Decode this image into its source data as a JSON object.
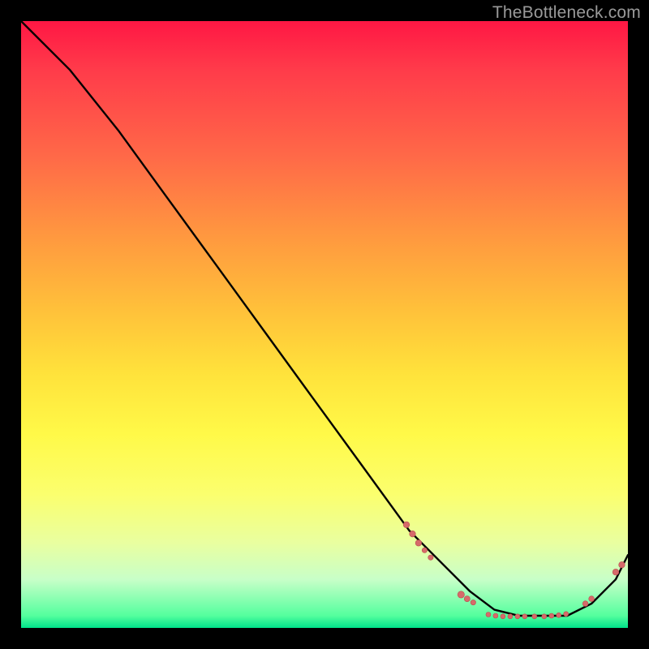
{
  "watermark": "TheBottleneck.com",
  "colors": {
    "line": "#000000",
    "marker_fill": "#d66a6a",
    "marker_stroke": "#b94e4e",
    "background": "#000000"
  },
  "chart_data": {
    "type": "line",
    "title": "",
    "xlabel": "",
    "ylabel": "",
    "xlim": [
      0,
      100
    ],
    "ylim": [
      0,
      100
    ],
    "grid": false,
    "legend": false,
    "series": [
      {
        "name": "curve",
        "x": [
          0,
          8,
          16,
          24,
          32,
          40,
          48,
          56,
          64,
          70,
          74,
          78,
          82,
          86,
          90,
          94,
          98,
          100
        ],
        "y": [
          100,
          92,
          82,
          71,
          60,
          49,
          38,
          27,
          16,
          10,
          6,
          3,
          2,
          2,
          2,
          4,
          8,
          12
        ]
      }
    ],
    "markers": [
      {
        "x": 63.5,
        "y": 17.0,
        "r": 3.8
      },
      {
        "x": 64.5,
        "y": 15.5,
        "r": 3.8
      },
      {
        "x": 65.5,
        "y": 14.0,
        "r": 3.8
      },
      {
        "x": 66.5,
        "y": 12.8,
        "r": 3.2
      },
      {
        "x": 67.5,
        "y": 11.6,
        "r": 3.2
      },
      {
        "x": 72.5,
        "y": 5.5,
        "r": 4.2
      },
      {
        "x": 73.5,
        "y": 4.8,
        "r": 3.6
      },
      {
        "x": 74.5,
        "y": 4.2,
        "r": 3.2
      },
      {
        "x": 77.0,
        "y": 2.2,
        "r": 3.0
      },
      {
        "x": 78.2,
        "y": 2.0,
        "r": 3.0
      },
      {
        "x": 79.4,
        "y": 1.9,
        "r": 3.0
      },
      {
        "x": 80.6,
        "y": 1.9,
        "r": 3.0
      },
      {
        "x": 81.8,
        "y": 1.9,
        "r": 3.0
      },
      {
        "x": 83.0,
        "y": 1.9,
        "r": 3.0
      },
      {
        "x": 84.6,
        "y": 1.9,
        "r": 3.0
      },
      {
        "x": 86.2,
        "y": 1.9,
        "r": 3.0
      },
      {
        "x": 87.4,
        "y": 2.0,
        "r": 3.0
      },
      {
        "x": 88.6,
        "y": 2.1,
        "r": 3.0
      },
      {
        "x": 89.8,
        "y": 2.3,
        "r": 3.0
      },
      {
        "x": 93.0,
        "y": 4.0,
        "r": 3.4
      },
      {
        "x": 94.0,
        "y": 4.8,
        "r": 3.4
      },
      {
        "x": 98.0,
        "y": 9.2,
        "r": 3.8
      },
      {
        "x": 99.0,
        "y": 10.4,
        "r": 3.8
      }
    ]
  }
}
